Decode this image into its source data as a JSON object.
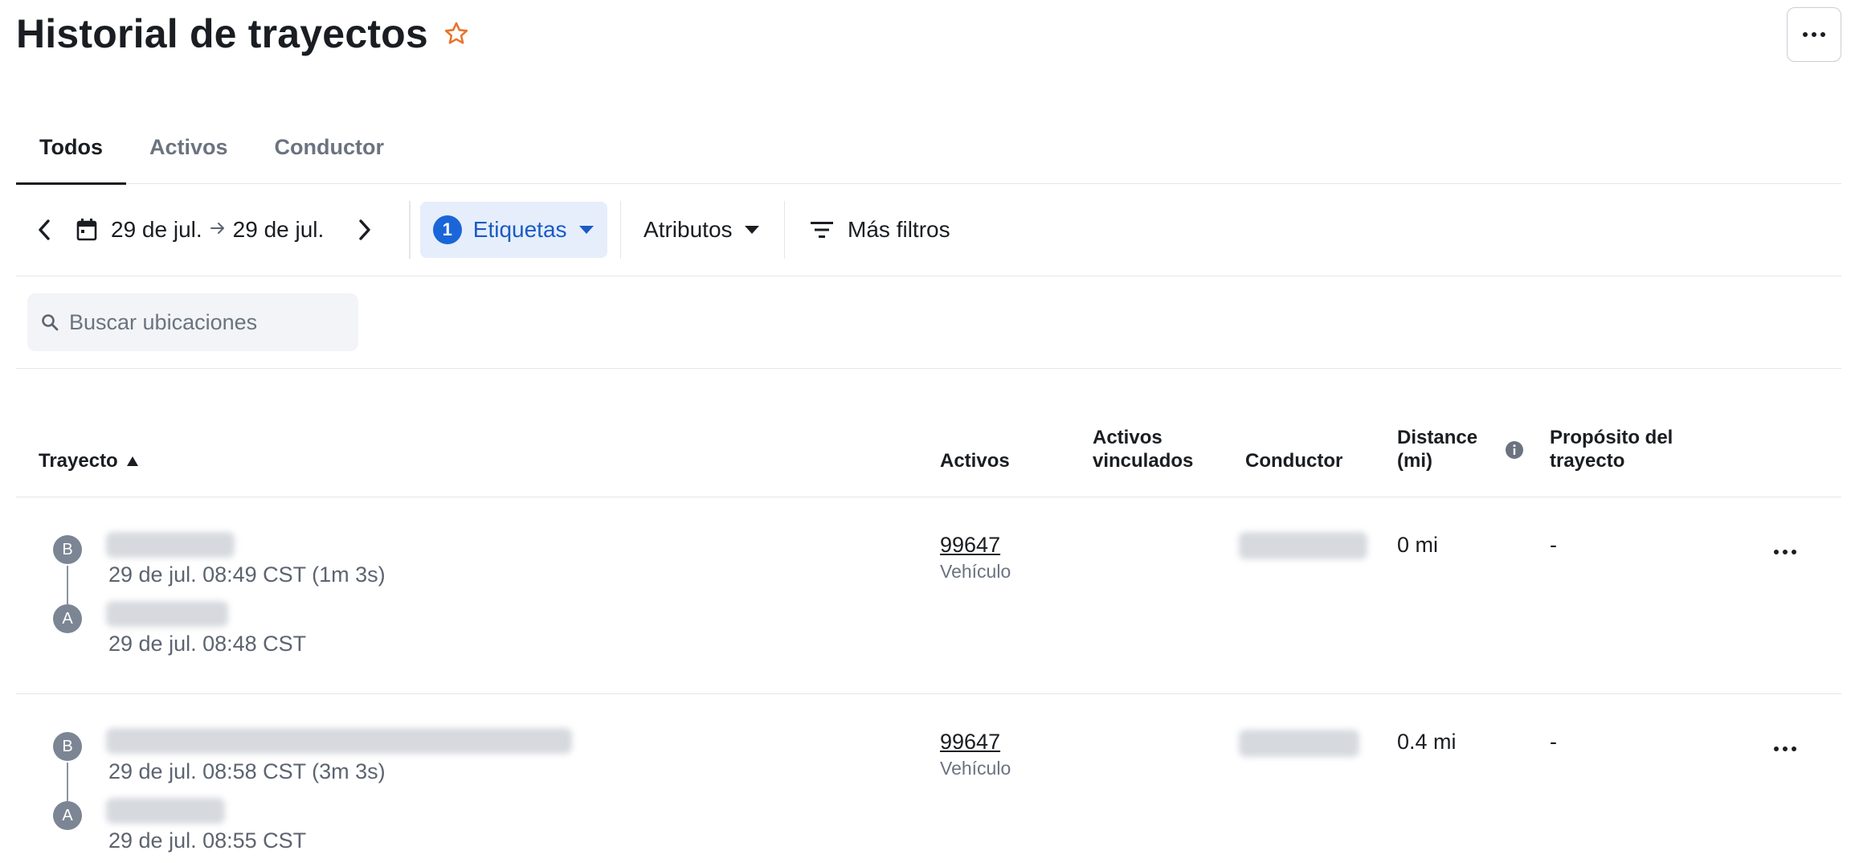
{
  "header": {
    "title": "Historial de trayectos",
    "favorite_icon": "star-outline-icon",
    "more_icon": "more-horizontal-icon"
  },
  "tabs": [
    {
      "label": "Todos",
      "active": true
    },
    {
      "label": "Activos",
      "active": false
    },
    {
      "label": "Conductor",
      "active": false
    }
  ],
  "filters": {
    "date_start": "29 de jul.",
    "date_arrow": "→",
    "date_end": "29 de jul.",
    "tags_count": "1",
    "tags_label": "Etiquetas",
    "attributes_label": "Atributos",
    "more_filters_label": "Más filtros"
  },
  "search": {
    "placeholder": "Buscar ubicaciones",
    "value": ""
  },
  "table": {
    "columns": {
      "route": "Trayecto",
      "assets": "Activos",
      "linked_assets_line1": "Activos",
      "linked_assets_line2": "vinculados",
      "driver": "Conductor",
      "distance_line1": "Distance",
      "distance_line2": "(mi)",
      "purpose_line1": "Propósito del",
      "purpose_line2": "trayecto"
    },
    "sort": {
      "column": "route",
      "direction": "asc"
    },
    "rows": [
      {
        "stop_b_label": "B",
        "stop_b_time": "29 de jul. 08:49 CST (1m 3s)",
        "stop_a_label": "A",
        "stop_a_time": "29 de jul. 08:48 CST",
        "asset_id": "99647",
        "asset_type": "Vehículo",
        "distance": "0 mi",
        "purpose": "-"
      },
      {
        "stop_b_label": "B",
        "stop_b_time": "29 de jul. 08:58 CST (3m 3s)",
        "stop_a_label": "A",
        "stop_a_time": "29 de jul. 08:55 CST",
        "asset_id": "99647",
        "asset_type": "Vehículo",
        "distance": "0.4 mi",
        "purpose": "-"
      }
    ]
  },
  "colors": {
    "accent": "#1a66d8",
    "tag_bg": "#e6eefb",
    "star": "#e8732a",
    "marker": "#7c8593"
  }
}
